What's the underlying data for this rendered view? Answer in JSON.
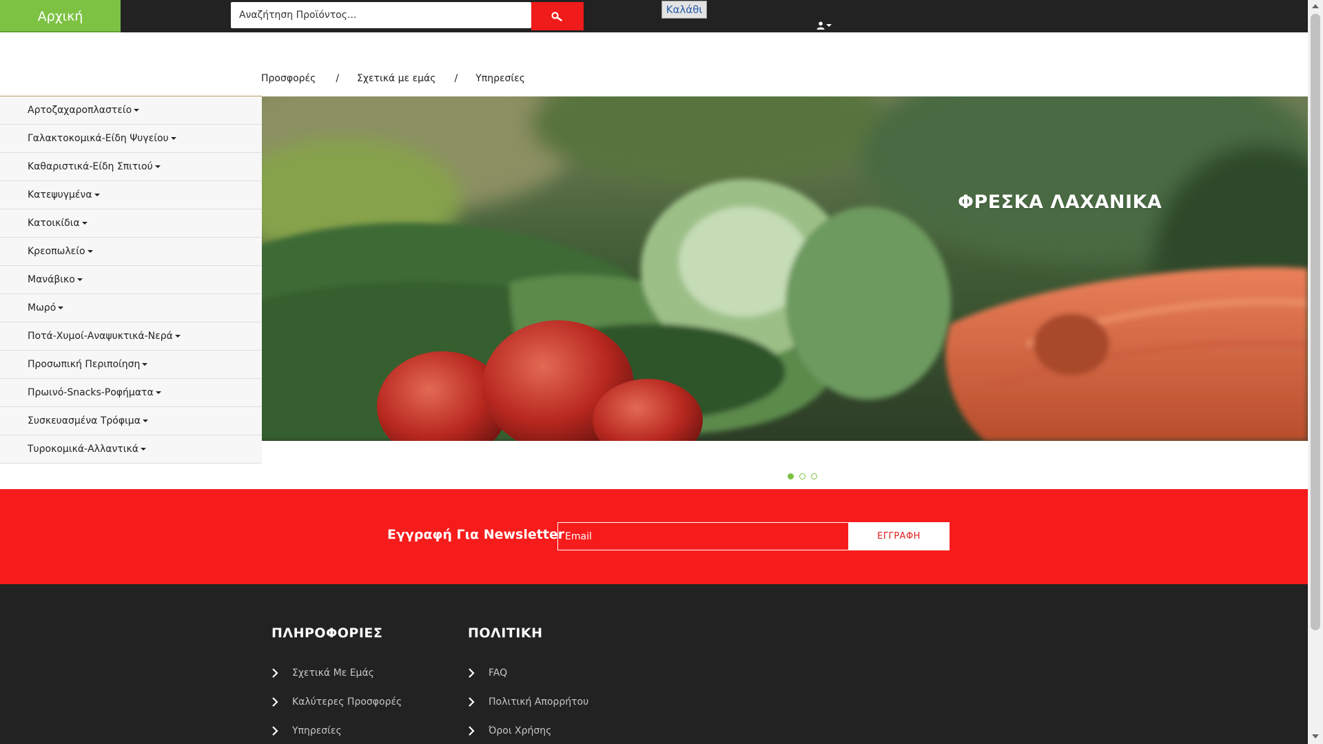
{
  "header": {
    "home_label": "Αρχική",
    "search_placeholder": "Αναζήτηση Προϊόντος...",
    "cart_label": "Καλάθι",
    "icons": {
      "search": "search-icon",
      "user": "user-icon",
      "caret": "caret-down-icon"
    }
  },
  "nav": {
    "items": [
      "Προσφορές",
      "Σχετικά με εμάς",
      "Υπηρεσίες"
    ],
    "separator": "/"
  },
  "sidebar": {
    "categories": [
      "Αρτοζαχαροπλαστείο",
      "Γαλακτοκομικά-Είδη Ψυγείου",
      "Καθαριστικά-Είδη Σπιτιού",
      "Κατεψυγμένα",
      "Κατοικίδια",
      "Κρεοπωλείο",
      "Μανάβικο",
      "Μωρό",
      "Ποτά-Χυμοί-Αναψυκτικά-Νερά",
      "Προσωπική Περιποίηση",
      "Πρωινό-Snacks-Ροφήματα",
      "Συσκευασμένα Τρόφιμα",
      "Τυροκομικά-Αλλαντικά"
    ]
  },
  "hero": {
    "caption": "ΦΡΕΣΚΑ ΛΑΧΑΝΙΚΑ",
    "slide_count": 3,
    "active_slide": 1
  },
  "newsletter": {
    "title": "Εγγραφή Για Newsletter",
    "email_placeholder": "Email",
    "button_label": "ΕΓΓΡΑΦΗ"
  },
  "footer": {
    "info": {
      "title": "ΠΛΗΡΟΦΟΡΙΕΣ",
      "links": [
        "Σχετικά Με Εμάς",
        "Καλύτερες Προσφορές",
        "Υπηρεσίες"
      ]
    },
    "policy": {
      "title": "ΠΟΛΙΤΙΚΗ",
      "links": [
        "FAQ",
        "Πολιτική Απορρήτου",
        "Όροι Χρήσης"
      ]
    }
  },
  "colors": {
    "brand_green": "#7dc243",
    "brand_red": "#f71c1c",
    "dark": "#222222"
  }
}
